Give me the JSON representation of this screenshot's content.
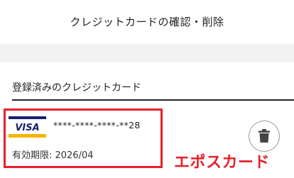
{
  "header": {
    "title": "クレジットカードの確認・削除"
  },
  "section": {
    "title": "登録済みのクレジットカード"
  },
  "card": {
    "brand": "VISA",
    "number": "****-****-****-**28",
    "expiry": "有効期限: 2026/04",
    "delete_icon": "trash-icon"
  },
  "annotation": {
    "text": "エポスカード"
  },
  "colors": {
    "highlight": "#e8202a",
    "visa_blue": "#1a1f71",
    "visa_gold": "#f7b600"
  }
}
